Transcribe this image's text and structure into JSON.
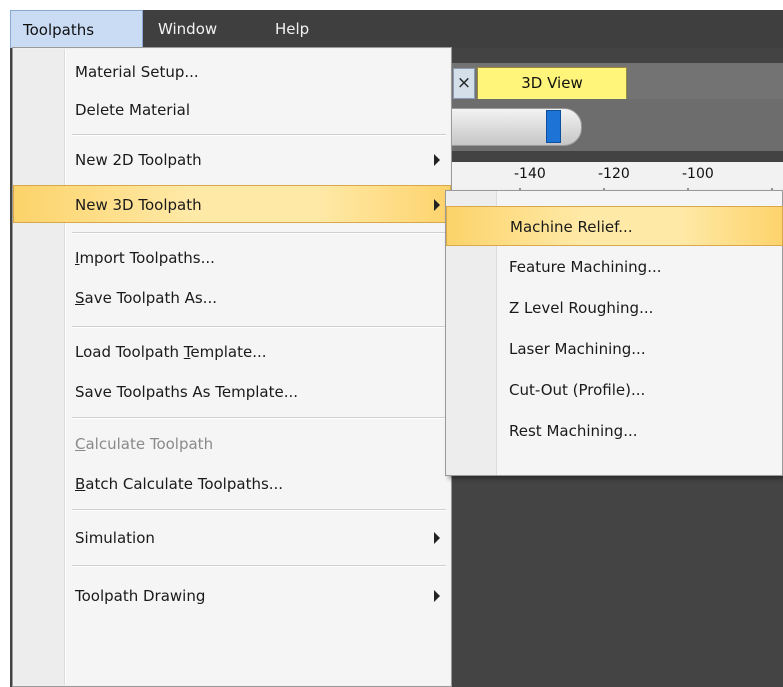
{
  "menubar": {
    "items": [
      {
        "label": "Toolpaths",
        "active": true
      },
      {
        "label": "Window",
        "active": false
      },
      {
        "label": "Help",
        "active": false
      }
    ]
  },
  "background": {
    "tab_close_glyph": "×",
    "tab_label": "3D View",
    "ruler_labels": [
      "-140",
      "-120",
      "-100"
    ]
  },
  "menu": {
    "material_setup": "Material Setup...",
    "delete_material": "Delete Material",
    "new_2d_toolpath": "New 2D Toolpath",
    "new_3d_toolpath": "New 3D Toolpath",
    "import_toolpaths_mnemonic": "I",
    "import_toolpaths_rest": "mport Toolpaths...",
    "save_toolpath_as_mnemonic": "S",
    "save_toolpath_as_rest": "ave Toolpath As...",
    "load_template_pre": "Load Toolpath ",
    "load_template_mnemonic": "T",
    "load_template_rest": "emplate...",
    "save_as_template": "Save Toolpaths As Template...",
    "calculate_mnemonic": "C",
    "calculate_rest": "alculate Toolpath",
    "batch_mnemonic": "B",
    "batch_rest": "atch Calculate Toolpaths...",
    "simulation": "Simulation",
    "toolpath_drawing": "Toolpath Drawing"
  },
  "submenu": {
    "items": [
      "Machine Relief...",
      "Feature Machining...",
      "Z Level Roughing...",
      "Laser Machining...",
      "Cut-Out (Profile)...",
      "Rest Machining..."
    ]
  },
  "colors": {
    "highlight": "#fde7a0",
    "menubar": "#3f3f3f",
    "tab_active": "#fff57a",
    "slider_thumb": "#1e73d6"
  }
}
